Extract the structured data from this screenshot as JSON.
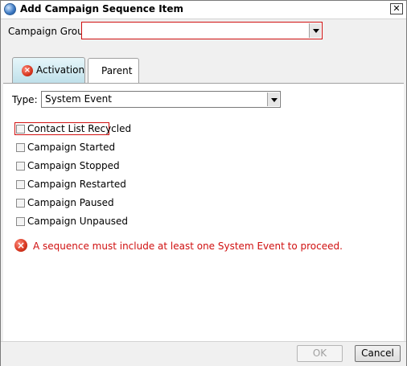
{
  "window": {
    "title": "Add Campaign Sequence Item",
    "close_glyph": "✕"
  },
  "campaign_group": {
    "label": "Campaign Group:",
    "value": ""
  },
  "tabs": [
    {
      "label": "Activation",
      "icon": "error-icon",
      "selected": false
    },
    {
      "label": "Parent",
      "selected": true
    }
  ],
  "type": {
    "label": "Type:",
    "value": "System Event"
  },
  "events": [
    {
      "label": "Contact List Recycled",
      "checked": false
    },
    {
      "label": "Campaign Started",
      "checked": false
    },
    {
      "label": "Campaign Stopped",
      "checked": false
    },
    {
      "label": "Campaign Restarted",
      "checked": false
    },
    {
      "label": "Campaign Paused",
      "checked": false
    },
    {
      "label": "Campaign Unpaused",
      "checked": false
    }
  ],
  "error": {
    "glyph": "×",
    "message": "A sequence must include at least one System Event to proceed."
  },
  "buttons": {
    "ok": "OK",
    "cancel": "Cancel"
  },
  "colors": {
    "error": "#d01010",
    "tab_active": "#bfe0ea"
  }
}
